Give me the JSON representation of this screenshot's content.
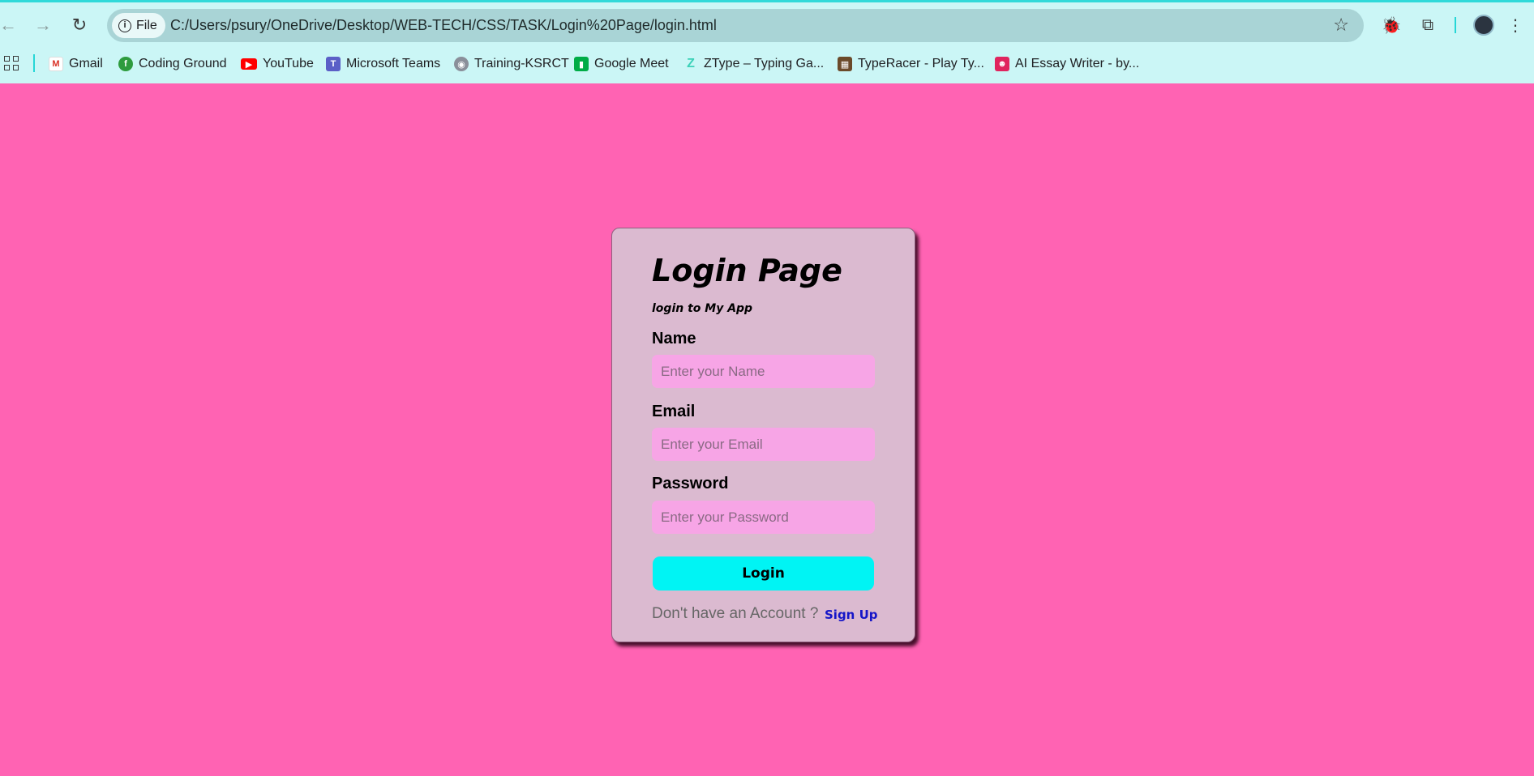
{
  "browser": {
    "site_chip_label": "File",
    "url": "C:/Users/psury/OneDrive/Desktop/WEB-TECH/CSS/TASK/Login%20Page/login.html",
    "accent_color": "#30d9d9",
    "bookmarks": [
      {
        "label": "Gmail",
        "icon": "gmail-icon"
      },
      {
        "label": "Coding Ground",
        "icon": "coding-ground-icon"
      },
      {
        "label": "YouTube",
        "icon": "youtube-icon"
      },
      {
        "label": "Microsoft Teams",
        "icon": "teams-icon"
      },
      {
        "label": "Training-KSRCT",
        "icon": "training-icon"
      },
      {
        "label": "Google Meet",
        "icon": "meet-icon"
      },
      {
        "label": "ZType – Typing Ga...",
        "icon": "ztype-icon"
      },
      {
        "label": "TypeRacer - Play Ty...",
        "icon": "typeracer-icon"
      },
      {
        "label": "AI Essay Writer - by...",
        "icon": "essay-writer-icon"
      }
    ]
  },
  "page": {
    "background_color": "#ff63b3",
    "card_color": "#dbbad0",
    "title": "Login Page",
    "subtitle": "login to My App",
    "fields": {
      "name": {
        "label": "Name",
        "placeholder": "Enter your Name",
        "value": ""
      },
      "email": {
        "label": "Email",
        "placeholder": "Enter your Email",
        "value": ""
      },
      "password": {
        "label": "Password",
        "placeholder": "Enter your Password",
        "value": ""
      }
    },
    "login_button": "Login",
    "login_button_color": "#00f4f4",
    "footer_text": "Don't have an Account ?",
    "signup_link": "Sign Up"
  }
}
